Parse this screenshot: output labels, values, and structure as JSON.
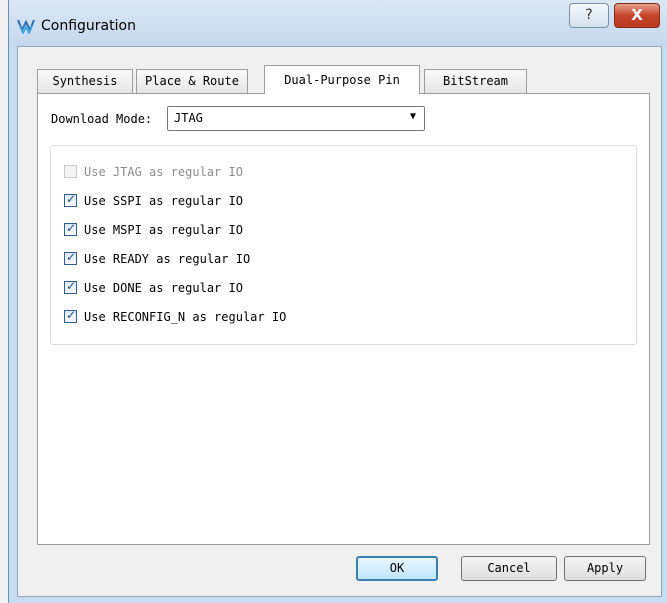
{
  "window": {
    "title": "Configuration",
    "help_label": "?",
    "close_label": "X"
  },
  "tabs": [
    {
      "label": "Synthesis",
      "active": false
    },
    {
      "label": "Place & Route",
      "active": false
    },
    {
      "label": "Dual-Purpose Pin",
      "active": true
    },
    {
      "label": "BitStream",
      "active": false
    }
  ],
  "download_mode": {
    "label": "Download Mode:",
    "value": "JTAG"
  },
  "options": [
    {
      "label": "Use JTAG as regular IO",
      "checked": false,
      "enabled": false
    },
    {
      "label": "Use SSPI as regular IO",
      "checked": true,
      "enabled": true
    },
    {
      "label": "Use MSPI as regular IO",
      "checked": true,
      "enabled": true
    },
    {
      "label": "Use READY as regular IO",
      "checked": true,
      "enabled": true
    },
    {
      "label": "Use DONE as regular IO",
      "checked": true,
      "enabled": true
    },
    {
      "label": "Use RECONFIG_N as regular IO",
      "checked": true,
      "enabled": true
    }
  ],
  "buttons": {
    "ok": "OK",
    "cancel": "Cancel",
    "apply": "Apply"
  },
  "colors": {
    "checkmark": "#1d4f91",
    "close_button": "#c6432b",
    "default_button_border": "#3c7fb1"
  }
}
